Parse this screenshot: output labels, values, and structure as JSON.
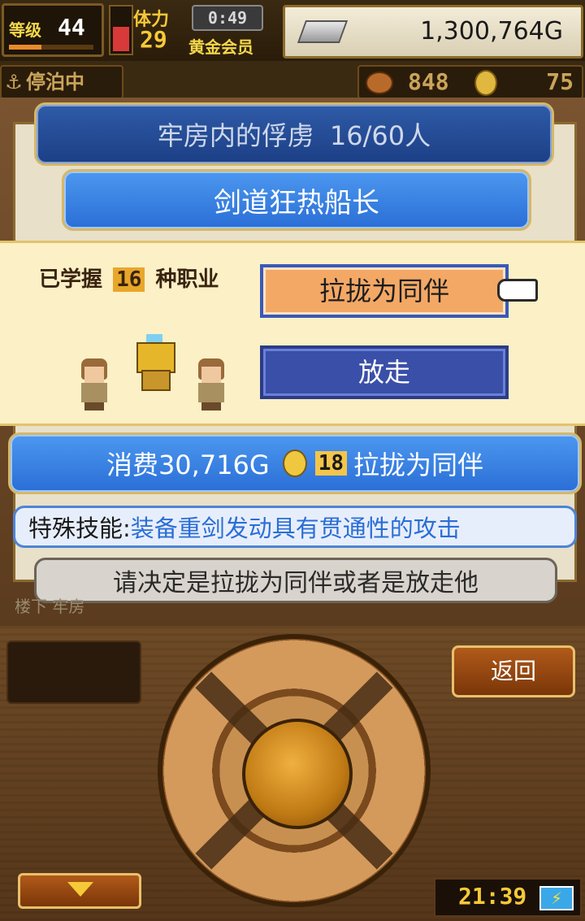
{
  "hud": {
    "level_label": "等级",
    "level_value": "44",
    "stamina_label": "体力",
    "stamina_value": "29",
    "time_label": "0:49",
    "membership": "黄金会员",
    "gold": "1,300,764G",
    "dock_status": "停泊中",
    "food_count": "848",
    "medal_count": "75"
  },
  "prisoner_banner": {
    "title": "牢房内的俘虏",
    "count": "16/60人"
  },
  "prisoner_name": "剑道狂热船长",
  "popup": {
    "learned_prefix": "已学握",
    "learned_count": "16",
    "learned_suffix": "种职业",
    "recruit_label": "拉拢为同伴",
    "release_label": "放走"
  },
  "cost_bar": {
    "prefix": "消费30,716G",
    "medals": "18",
    "suffix": "拉拢为同伴"
  },
  "skill": {
    "label": "特殊技能:",
    "value": "装备重剑发动具有贯通性的攻击"
  },
  "prompt": "请决定是拉拢为同伴或者是放走他",
  "location": "楼下 牢房",
  "back_label": "返回",
  "clock": "21:39",
  "colors": {
    "banner_blue": "#2a6ed6",
    "popup_cream": "#fbf0c6",
    "recruit_orange": "#f3a865",
    "release_blue": "#3a4fa8",
    "skill_text_blue": "#2a6ed6"
  }
}
